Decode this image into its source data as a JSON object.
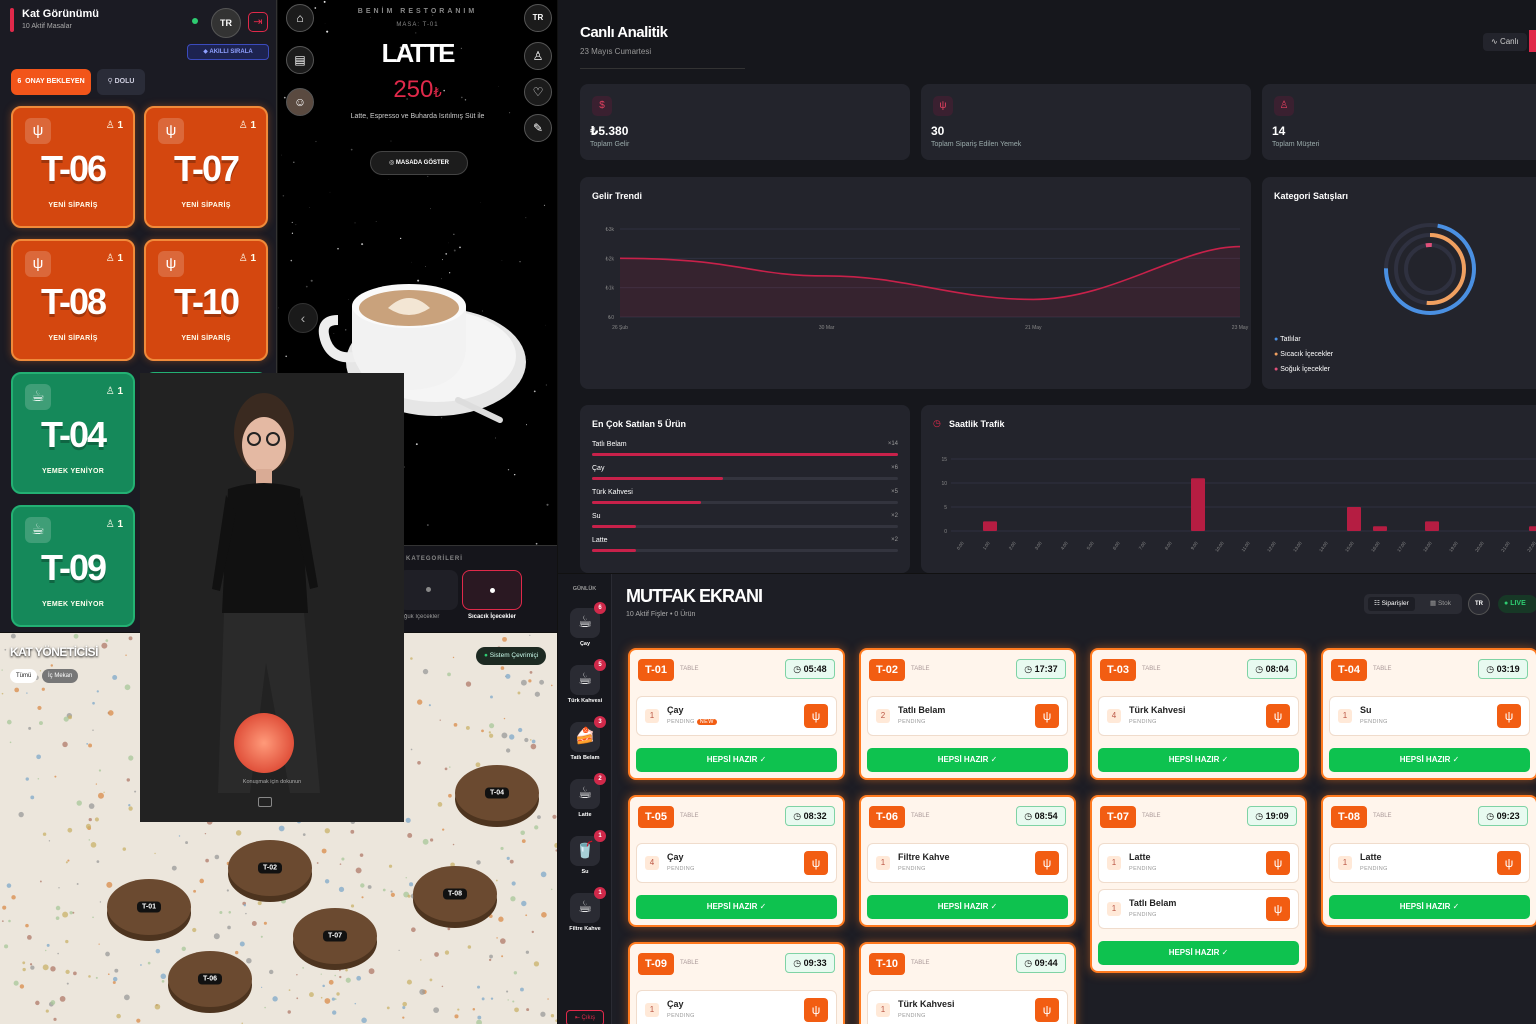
{
  "floor": {
    "title": "Kat Görünümü",
    "subtitle": "10 Aktif Masalar",
    "lang": "TR",
    "smart_sort": "AKILLI SIRALA",
    "filters": [
      {
        "label": "ONAY BEKLEYEN",
        "count": "6"
      },
      {
        "label": "DOLU",
        "count": ""
      }
    ],
    "tables": [
      {
        "name": "T-06",
        "status": "YENİ SİPARİŞ",
        "count": "1",
        "color": "orange"
      },
      {
        "name": "T-07",
        "status": "YENİ SİPARİŞ",
        "count": "1",
        "color": "orange"
      },
      {
        "name": "T-08",
        "status": "YENİ SİPARİŞ",
        "count": "1",
        "color": "orange"
      },
      {
        "name": "T-10",
        "status": "YENİ SİPARİŞ",
        "count": "1",
        "color": "orange"
      },
      {
        "name": "T-04",
        "status": "YEMEK YENİYOR",
        "count": "1",
        "color": "green"
      },
      {
        "name": "T-09",
        "status": "YEMEK YENİYOR",
        "count": "1",
        "color": "green"
      }
    ]
  },
  "menu": {
    "restaurant": "BENİM RESTORANIM",
    "table": "MASA: T-01",
    "item_name": "LATTE",
    "price": "250",
    "currency": "₺",
    "description": "Latte, Espresso ve Buharda Isıtılmış Süt ile",
    "show_btn": "MASADA GÖSTER",
    "lang": "TR",
    "categories_label": "KATEGORİLERİ",
    "categories": [
      "Soğuk İçecekler",
      "Sıcacık İçecekler"
    ]
  },
  "avatar": {
    "hint": "Konuşmak için dokunun"
  },
  "floor3d": {
    "title": "KAT YÖNETİCİSİ",
    "tabs": [
      "Tümü",
      "İç Mekan"
    ],
    "system_status": "Sistem Çevrimiçi",
    "tables": [
      "T-04",
      "T-02",
      "T-01",
      "T-08",
      "T-07",
      "T-06"
    ]
  },
  "analytics": {
    "title": "Canlı Analitik",
    "date": "23 Mayıs Cumartesi",
    "live_btn": "Canlı",
    "kpis": [
      {
        "value": "₺5.380",
        "label": "Toplam Gelir"
      },
      {
        "value": "30",
        "label": "Toplam Sipariş Edilen Yemek"
      },
      {
        "value": "14",
        "label": "Toplam Müşteri"
      }
    ],
    "revenue_title": "Gelir Trendi",
    "category_title": "Kategori Satışları",
    "category_legend": [
      {
        "name": "Tatlılar",
        "color": "#4a90e2"
      },
      {
        "name": "Sıcacık İçecekler",
        "color": "#f0a060"
      },
      {
        "name": "Soğuk İçecekler",
        "color": "#e0507a"
      }
    ],
    "top5_title": "En Çok Satılan 5 Ürün",
    "top5": [
      {
        "name": "Tatlı Belam",
        "count": "×14",
        "value": 14
      },
      {
        "name": "Çay",
        "count": "×6",
        "value": 6
      },
      {
        "name": "Türk Kahvesi",
        "count": "×5",
        "value": 5
      },
      {
        "name": "Su",
        "count": "×2",
        "value": 2
      },
      {
        "name": "Latte",
        "count": "×2",
        "value": 2
      }
    ],
    "traffic_title": "Saatlik Trafik"
  },
  "chart_data": [
    {
      "type": "line",
      "title": "Gelir Trendi",
      "x": [
        "26 Şub",
        "30 Mar",
        "21 May",
        "23 May"
      ],
      "yticks": [
        "₺0",
        "₺1k",
        "₺2k",
        "₺3k"
      ],
      "ylim": [
        0,
        3000
      ],
      "series": [
        {
          "values": [
            2000,
            1400,
            600,
            2400
          ]
        }
      ]
    },
    {
      "type": "bar",
      "title": "Saatlik Trafik",
      "categories": [
        "0:00",
        "1:00",
        "2:00",
        "3:00",
        "4:00",
        "5:00",
        "6:00",
        "7:00",
        "8:00",
        "9:00",
        "10:00",
        "11:00",
        "12:00",
        "13:00",
        "14:00",
        "15:00",
        "16:00",
        "17:00",
        "18:00",
        "19:00",
        "20:00",
        "21:00",
        "22:00"
      ],
      "values": [
        0,
        2,
        0,
        0,
        0,
        0,
        0,
        0,
        0,
        11,
        0,
        0,
        0,
        0,
        0,
        5,
        1,
        0,
        2,
        0,
        0,
        0,
        1
      ],
      "yticks": [
        "0",
        "5",
        "10",
        "15"
      ],
      "ylim": [
        0,
        15
      ]
    }
  ],
  "kitchen": {
    "title": "MUTFAK EKRANI",
    "subtitle": "10 Aktif Fişler • 0 Ürün",
    "tabs": [
      "Siparişler",
      "Stok"
    ],
    "lang": "TR",
    "live": "LIVE",
    "rail_title": "GÜNLÜK",
    "rail": [
      {
        "name": "Çay",
        "count": "6",
        "icon": "☕"
      },
      {
        "name": "Türk Kahvesi",
        "count": "5",
        "icon": "☕"
      },
      {
        "name": "Tatlı Belam",
        "count": "3",
        "icon": "🍰"
      },
      {
        "name": "Latte",
        "count": "2",
        "icon": "☕"
      },
      {
        "name": "Su",
        "count": "1",
        "icon": "🥤"
      },
      {
        "name": "Filtre Kahve",
        "count": "1",
        "icon": "☕"
      }
    ],
    "rail_footer": "Çıkış",
    "table_label": "TABLE",
    "ready_label": "HEPSİ HAZIR",
    "pending_label": "PENDING",
    "new_label": "NEW",
    "tickets": [
      {
        "table": "T-01",
        "time": "05:48",
        "items": [
          {
            "qty": "1",
            "name": "Çay",
            "new": true
          }
        ]
      },
      {
        "table": "T-02",
        "time": "17:37",
        "items": [
          {
            "qty": "2",
            "name": "Tatlı Belam"
          }
        ]
      },
      {
        "table": "T-03",
        "time": "08:04",
        "items": [
          {
            "qty": "4",
            "name": "Türk Kahvesi"
          }
        ]
      },
      {
        "table": "T-04",
        "time": "03:19",
        "items": [
          {
            "qty": "1",
            "name": "Su"
          }
        ]
      },
      {
        "table": "T-05",
        "time": "08:32",
        "items": [
          {
            "qty": "4",
            "name": "Çay"
          }
        ]
      },
      {
        "table": "T-06",
        "time": "08:54",
        "items": [
          {
            "qty": "1",
            "name": "Filtre Kahve"
          }
        ]
      },
      {
        "table": "T-07",
        "time": "19:09",
        "items": [
          {
            "qty": "1",
            "name": "Latte"
          },
          {
            "qty": "1",
            "name": "Tatlı Belam"
          }
        ]
      },
      {
        "table": "T-08",
        "time": "09:23",
        "items": [
          {
            "qty": "1",
            "name": "Latte"
          }
        ]
      },
      {
        "table": "T-09",
        "time": "09:33",
        "items": [
          {
            "qty": "1",
            "name": "Çay"
          }
        ]
      },
      {
        "table": "T-10",
        "time": "09:44",
        "items": [
          {
            "qty": "1",
            "name": "Türk Kahvesi"
          }
        ]
      }
    ]
  }
}
